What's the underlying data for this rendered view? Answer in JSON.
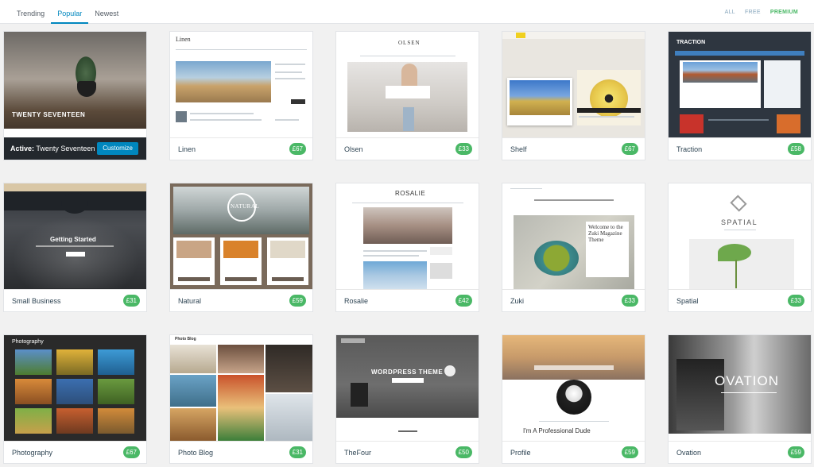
{
  "tabs": [
    {
      "label": "Trending"
    },
    {
      "label": "Popular"
    },
    {
      "label": "Newest"
    }
  ],
  "filters": [
    {
      "label": "ALL"
    },
    {
      "label": "FREE"
    },
    {
      "label": "PREMIUM"
    }
  ],
  "active_theme": {
    "prefix": "Active:",
    "name": "Twenty Seventeen",
    "customize_label": "Customize",
    "preview_title": "TWENTY SEVENTEEN"
  },
  "themes": [
    {
      "name": "Linen",
      "price": "£67",
      "preview_title": "Linen"
    },
    {
      "name": "Olsen",
      "price": "£33",
      "preview_title": "OLSEN"
    },
    {
      "name": "Shelf",
      "price": "£67",
      "preview_title": ""
    },
    {
      "name": "Traction",
      "price": "£58",
      "preview_title": "TRACTION"
    },
    {
      "name": "Small Business",
      "price": "£31",
      "preview_title": "Getting Started"
    },
    {
      "name": "Natural",
      "price": "£59",
      "preview_title": "NATURAL"
    },
    {
      "name": "Rosalie",
      "price": "£42",
      "preview_title": "ROSALIE"
    },
    {
      "name": "Zuki",
      "price": "£33",
      "preview_title": "Welcome to the Zuki Magazine Theme"
    },
    {
      "name": "Spatial",
      "price": "£33",
      "preview_title": "SPATIAL"
    },
    {
      "name": "Photography",
      "price": "£67",
      "preview_title": "Photography"
    },
    {
      "name": "Photo Blog",
      "price": "£31",
      "preview_title": "Photo Blog"
    },
    {
      "name": "TheFour",
      "price": "£50",
      "preview_title": "WORDPRESS THEME"
    },
    {
      "name": "Profile",
      "price": "£59",
      "preview_title": "I'm A Professional Dude"
    },
    {
      "name": "Ovation",
      "price": "£59",
      "preview_title": "OVATION"
    }
  ],
  "colors": {
    "accent": "#0087be",
    "price_badge": "#4ab866",
    "active_bar": "#23282d"
  }
}
